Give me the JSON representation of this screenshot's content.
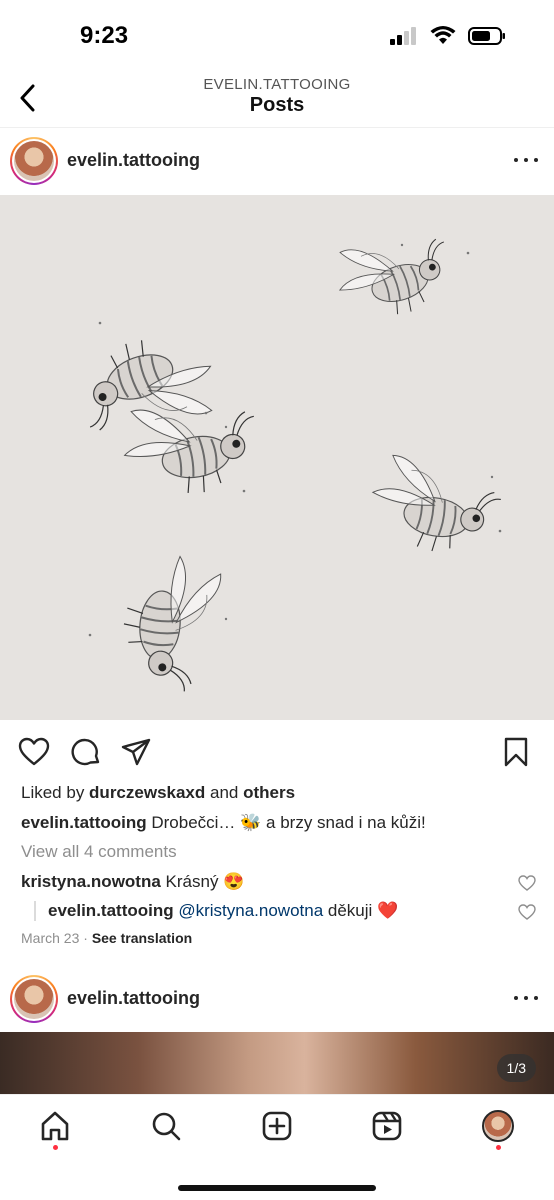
{
  "status": {
    "time": "9:23"
  },
  "header": {
    "subtitle": "EVELIN.TATTOOING",
    "title": "Posts"
  },
  "post1": {
    "username": "evelin.tattooing",
    "liked_prefix": "Liked by ",
    "liked_user": "durczewskaxd",
    "liked_and": " and ",
    "liked_others": "others",
    "caption_user": "evelin.tattooing",
    "caption_text": " Drobečci… 🐝 a brzy snad i na kůži!",
    "view_all": "View all 4 comments",
    "comments": [
      {
        "user": "kristyna.nowotna",
        "text": " Krásný 😍"
      },
      {
        "user": "evelin.tattooing",
        "mention": " @kristyna.nowotna",
        "text": " děkuji ❤️"
      }
    ],
    "date": "March 23",
    "separator": " · ",
    "see_translation": "See translation"
  },
  "post2": {
    "username": "evelin.tattooing",
    "counter": "1/3"
  },
  "icons": {
    "back": "chevron-left-icon",
    "more": "more-horizontal-icon",
    "like": "heart-icon",
    "comment": "comment-icon",
    "share": "send-icon",
    "save": "bookmark-icon",
    "tabs": [
      "home-icon",
      "search-icon",
      "create-icon",
      "reels-icon",
      "profile-avatar"
    ]
  },
  "colors": {
    "accent_dot": "#ff3040",
    "mention": "#00376b",
    "muted": "#8e8e8e"
  }
}
